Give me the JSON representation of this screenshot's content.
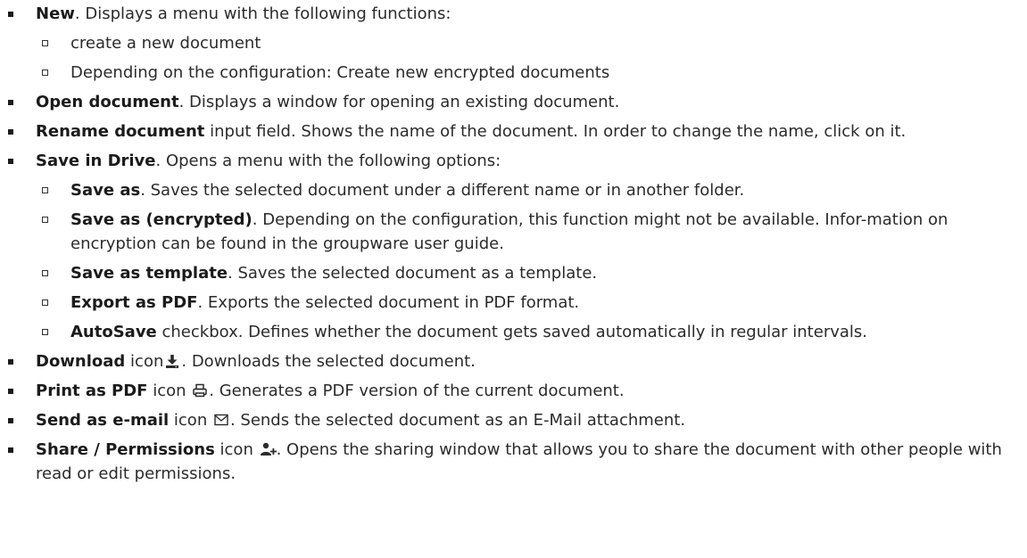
{
  "items": [
    {
      "bold": "New",
      "text": ". Displays a menu with the following functions:",
      "children": [
        {
          "text": "create a new document"
        },
        {
          "text": "Depending on the configuration: Create new encrypted documents"
        }
      ]
    },
    {
      "bold": "Open document",
      "text": ". Displays a window for opening an existing document."
    },
    {
      "bold": "Rename document",
      "text": " input field. Shows the name of the document. In order to change the name, click on it."
    },
    {
      "bold": "Save in Drive",
      "text": ". Opens a menu with the following options:",
      "children": [
        {
          "bold": "Save as",
          "text": ". Saves the selected document under a different name or in another folder."
        },
        {
          "bold": "Save as (encrypted)",
          "text": ". Depending on the configuration, this function might not be available. Infor-mation on encryption can be found in the groupware user guide."
        },
        {
          "bold": "Save as template",
          "text": ". Saves the selected document as a template."
        },
        {
          "bold": "Export as PDF",
          "text": ". Exports the selected document in PDF format."
        },
        {
          "bold": "AutoSave",
          "text": " checkbox. Defines whether the document gets saved automatically in regular intervals."
        }
      ]
    },
    {
      "bold": "Download",
      "pre_icon": " icon",
      "icon": "download-icon",
      "text": ". Downloads the selected document."
    },
    {
      "bold": "Print as PDF",
      "pre_icon": " icon ",
      "icon": "print-icon",
      "text": ". Generates a PDF version of the current document."
    },
    {
      "bold": "Send as e-mail",
      "pre_icon": " icon ",
      "icon": "envelope-icon",
      "text": ". Sends the selected document as an E-Mail attachment."
    },
    {
      "bold": "Share / Permissions",
      "pre_icon": " icon ",
      "icon": "user-plus-icon",
      "text": ". Opens the sharing window that allows you to share the document with other people with read or edit permissions."
    }
  ]
}
